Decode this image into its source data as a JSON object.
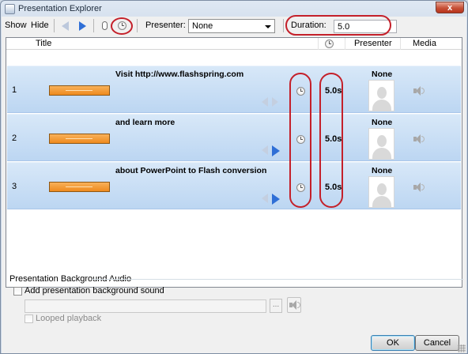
{
  "window": {
    "title": "Presentation Explorer",
    "close_glyph": "x"
  },
  "toolbar": {
    "show_label": "Show",
    "hide_label": "Hide",
    "presenter_label": "Presenter:",
    "presenter_value": "None",
    "duration_label": "Duration:",
    "duration_value": "5.0",
    "icons": [
      "prev-arrow-icon",
      "next-arrow-icon",
      "mouse-icon",
      "timing-clock-icon"
    ]
  },
  "list": {
    "columns": {
      "title": "Title",
      "timing": "timing-clock-icon",
      "presenter": "Presenter",
      "media": "Media"
    },
    "rows": [
      {
        "number": "1",
        "title": "Visit http://www.flashspring.com",
        "duration": "5.0s",
        "presenter": "None"
      },
      {
        "number": "2",
        "title": "and learn more",
        "duration": "5.0s",
        "presenter": "None"
      },
      {
        "number": "3",
        "title": "about PowerPoint to Flash conversion",
        "duration": "5.0s",
        "presenter": "None"
      }
    ]
  },
  "audio": {
    "group_label": "Presentation Background Audio",
    "add_sound_label": "Add presentation background sound",
    "add_sound_checked": false,
    "browse_label": "...",
    "looped_label": "Looped playback",
    "looped_checked": false
  },
  "buttons": {
    "ok": "OK",
    "cancel": "Cancel"
  },
  "colors": {
    "row_fill": "#c9dff5",
    "accent": "#2f6fd6",
    "annotation_red": "#c4202a",
    "thumbnail": "#f19a2f"
  }
}
